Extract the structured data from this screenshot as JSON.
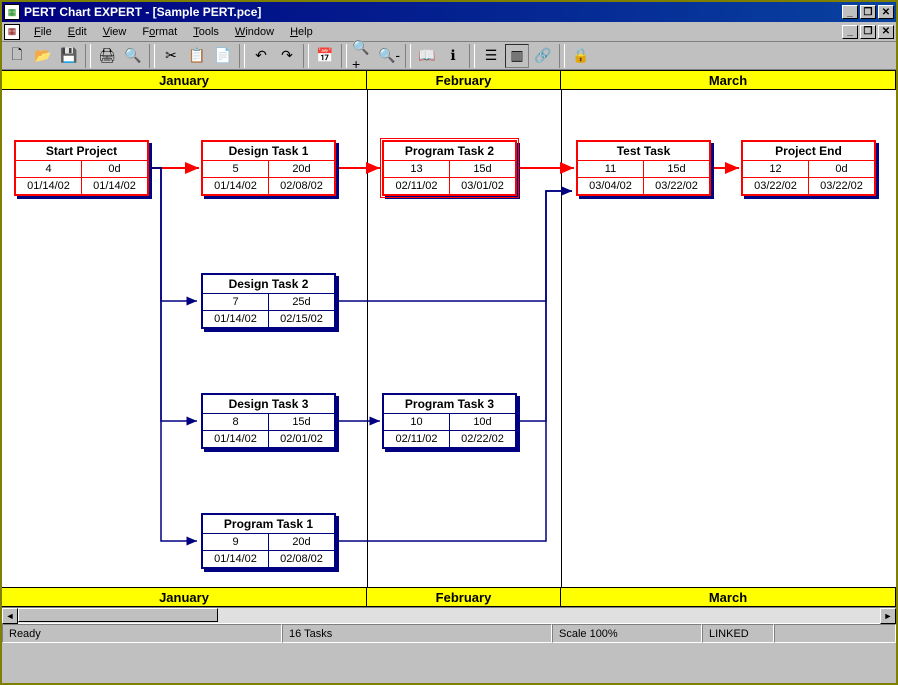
{
  "title": "PERT Chart EXPERT - [Sample PERT.pce]",
  "menu": [
    "File",
    "Edit",
    "View",
    "Format",
    "Tools",
    "Window",
    "Help"
  ],
  "months": [
    "January",
    "February",
    "March"
  ],
  "tasks": {
    "start": {
      "name": "Start Project",
      "id": "4",
      "dur": "0d",
      "d1": "01/14/02",
      "d2": "01/14/02",
      "critical": true
    },
    "design1": {
      "name": "Design Task 1",
      "id": "5",
      "dur": "20d",
      "d1": "01/14/02",
      "d2": "02/08/02",
      "critical": true
    },
    "program2": {
      "name": "Program Task 2",
      "id": "13",
      "dur": "15d",
      "d1": "02/11/02",
      "d2": "03/01/02",
      "critical": true,
      "highlight": true
    },
    "test": {
      "name": "Test Task",
      "id": "11",
      "dur": "15d",
      "d1": "03/04/02",
      "d2": "03/22/02",
      "critical": true
    },
    "end": {
      "name": "Project End",
      "id": "12",
      "dur": "0d",
      "d1": "03/22/02",
      "d2": "03/22/02",
      "critical": true
    },
    "design2": {
      "name": "Design Task 2",
      "id": "7",
      "dur": "25d",
      "d1": "01/14/02",
      "d2": "02/15/02",
      "critical": false
    },
    "design3": {
      "name": "Design Task 3",
      "id": "8",
      "dur": "15d",
      "d1": "01/14/02",
      "d2": "02/01/02",
      "critical": false
    },
    "program3": {
      "name": "Program Task 3",
      "id": "10",
      "dur": "10d",
      "d1": "02/11/02",
      "d2": "02/22/02",
      "critical": false
    },
    "program1": {
      "name": "Program Task 1",
      "id": "9",
      "dur": "20d",
      "d1": "01/14/02",
      "d2": "02/08/02",
      "critical": false
    }
  },
  "status": {
    "ready": "Ready",
    "taskcount": "16 Tasks",
    "scale": "Scale 100%",
    "linked": "LINKED"
  },
  "chart_data": {
    "type": "pert",
    "nodes": [
      {
        "id": 4,
        "name": "Start Project",
        "duration_days": 0,
        "start": "2002-01-14",
        "end": "2002-01-14",
        "critical": true
      },
      {
        "id": 5,
        "name": "Design Task 1",
        "duration_days": 20,
        "start": "2002-01-14",
        "end": "2002-02-08",
        "critical": true
      },
      {
        "id": 7,
        "name": "Design Task 2",
        "duration_days": 25,
        "start": "2002-01-14",
        "end": "2002-02-15",
        "critical": false
      },
      {
        "id": 8,
        "name": "Design Task 3",
        "duration_days": 15,
        "start": "2002-01-14",
        "end": "2002-02-01",
        "critical": false
      },
      {
        "id": 9,
        "name": "Program Task 1",
        "duration_days": 20,
        "start": "2002-01-14",
        "end": "2002-02-08",
        "critical": false
      },
      {
        "id": 10,
        "name": "Program Task 3",
        "duration_days": 10,
        "start": "2002-02-11",
        "end": "2002-02-22",
        "critical": false
      },
      {
        "id": 11,
        "name": "Test Task",
        "duration_days": 15,
        "start": "2002-03-04",
        "end": "2002-03-22",
        "critical": true
      },
      {
        "id": 12,
        "name": "Project End",
        "duration_days": 0,
        "start": "2002-03-22",
        "end": "2002-03-22",
        "critical": true
      },
      {
        "id": 13,
        "name": "Program Task 2",
        "duration_days": 15,
        "start": "2002-02-11",
        "end": "2002-03-01",
        "critical": true
      }
    ],
    "edges": [
      {
        "from": 4,
        "to": 5,
        "critical": true
      },
      {
        "from": 5,
        "to": 13,
        "critical": true
      },
      {
        "from": 13,
        "to": 11,
        "critical": true
      },
      {
        "from": 11,
        "to": 12,
        "critical": true
      },
      {
        "from": 4,
        "to": 7,
        "critical": false
      },
      {
        "from": 4,
        "to": 8,
        "critical": false
      },
      {
        "from": 4,
        "to": 9,
        "critical": false
      },
      {
        "from": 8,
        "to": 10,
        "critical": false
      },
      {
        "from": 7,
        "to": 11,
        "critical": false
      },
      {
        "from": 10,
        "to": 11,
        "critical": false
      },
      {
        "from": 9,
        "to": 11,
        "critical": false
      }
    ],
    "timeline_months": [
      "January",
      "February",
      "March"
    ]
  }
}
